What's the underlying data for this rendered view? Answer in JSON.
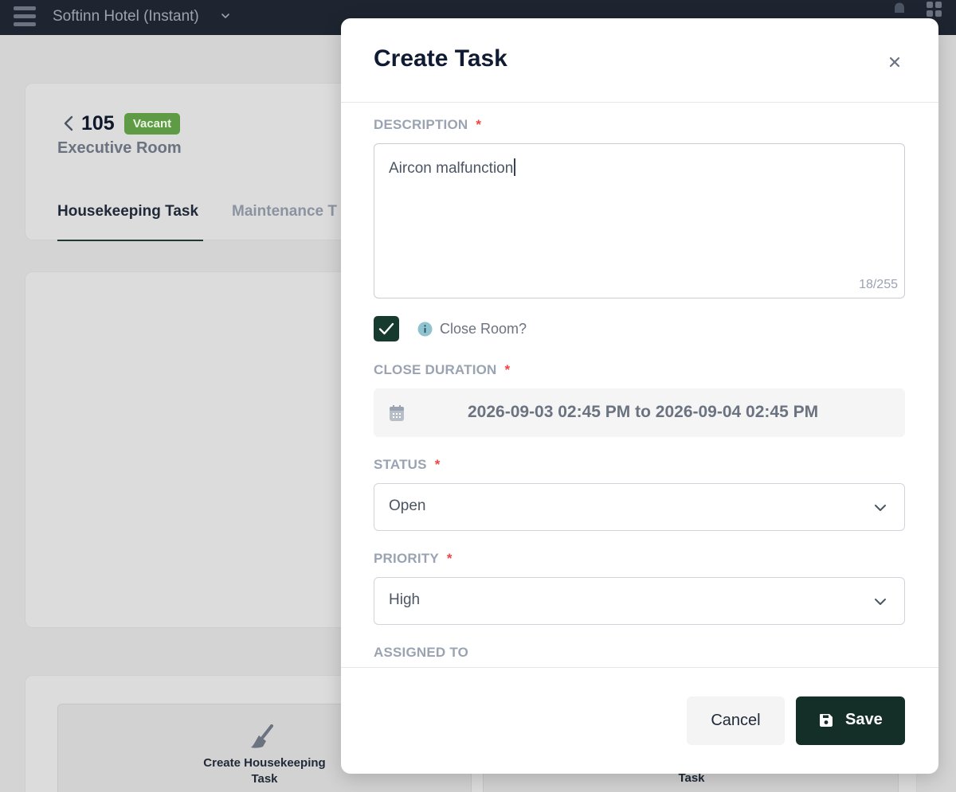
{
  "app": {
    "hotel_name": "Softinn Hotel (Instant)"
  },
  "room": {
    "number": "105",
    "status_badge": "Vacant",
    "type": "Executive Room",
    "tabs": [
      {
        "label": "Housekeeping Task"
      },
      {
        "label": "Maintenance T"
      }
    ]
  },
  "actions": {
    "create_housekeeping": "Create Housekeeping Task",
    "create_maintenance_partial": "Task"
  },
  "modal": {
    "title": "Create Task",
    "description": {
      "label": "DESCRIPTION",
      "required_mark": "*",
      "value": "Aircon malfunction",
      "char_count": "18/255"
    },
    "close_room": {
      "label": "Close Room?",
      "checked": true
    },
    "close_duration": {
      "label": "CLOSE DURATION",
      "required_mark": "*",
      "value": "2026-09-03 02:45 PM to 2026-09-04 02:45 PM"
    },
    "status": {
      "label": "STATUS",
      "required_mark": "*",
      "value": "Open"
    },
    "priority": {
      "label": "PRIORITY",
      "required_mark": "*",
      "value": "High"
    },
    "assigned_to": {
      "label": "ASSIGNED TO"
    },
    "buttons": {
      "cancel": "Cancel",
      "save": "Save"
    }
  },
  "colors": {
    "primary_dark_green": "#142f27",
    "badge_green": "#5f9b45",
    "required_red": "#ef4444",
    "topbar": "#1e2530"
  },
  "icons": [
    "hamburger-menu-icon",
    "chevron-down-icon",
    "bell-icon",
    "apps-icon",
    "chevron-left-icon",
    "broom-icon",
    "close-icon",
    "check-icon",
    "info-icon",
    "calendar-icon",
    "save-icon"
  ]
}
